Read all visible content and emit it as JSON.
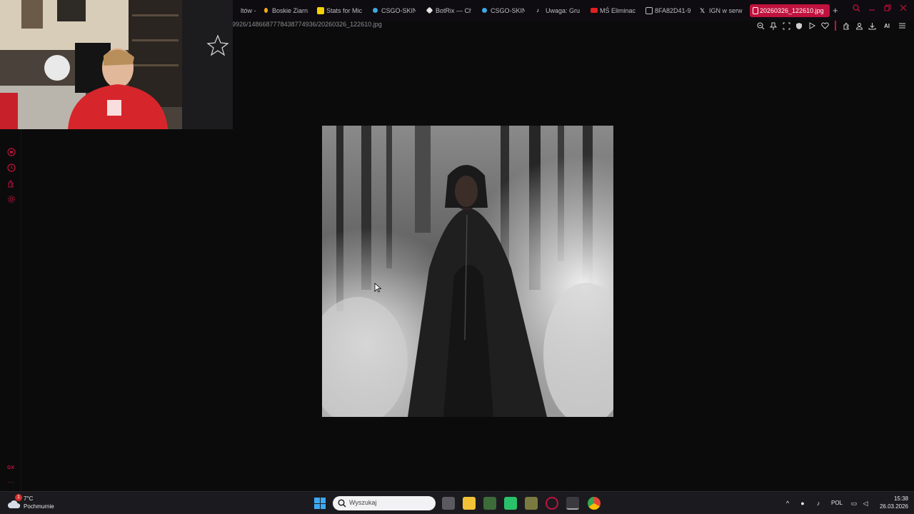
{
  "tabs": [
    {
      "label": "ltów - ",
      "color": "#8a8a90"
    },
    {
      "label": "Boskie Ziarn",
      "color": "#f3a81c"
    },
    {
      "label": "Stats for Mic",
      "color": "#f5d200"
    },
    {
      "label": "CSGO-SKIN",
      "color": "#41a7e1"
    },
    {
      "label": "BotRix — Ch",
      "color": "#e6e6e6"
    },
    {
      "label": "CSGO-SKIN",
      "color": "#41a7e1"
    },
    {
      "label": "Uwaga: Gru",
      "color": "#ffffff"
    },
    {
      "label": "MŚ Eliminac",
      "color": "#e02020"
    },
    {
      "label": "8FA82D41-9",
      "color": "#bdbdc2"
    },
    {
      "label": "IGN w serw",
      "color": "#ffffff"
    },
    {
      "label": "20260326_122610.jpg",
      "color": "#ffffff",
      "active": true
    }
  ],
  "address": {
    "url": "9926/1486687778438774936/20260326_122610.jpg"
  },
  "toolbar": {
    "ai_label": "AI"
  },
  "colors": {
    "accent": "#c0123e",
    "page_bg": "#0b0b0c"
  },
  "taskbar": {
    "weather_badge": "1",
    "temperature": "7°C",
    "condition": "Pochmurnie",
    "search_placeholder": "Wyszukaj",
    "language": "POL",
    "time": "15:38",
    "date": "26.03.2026"
  }
}
